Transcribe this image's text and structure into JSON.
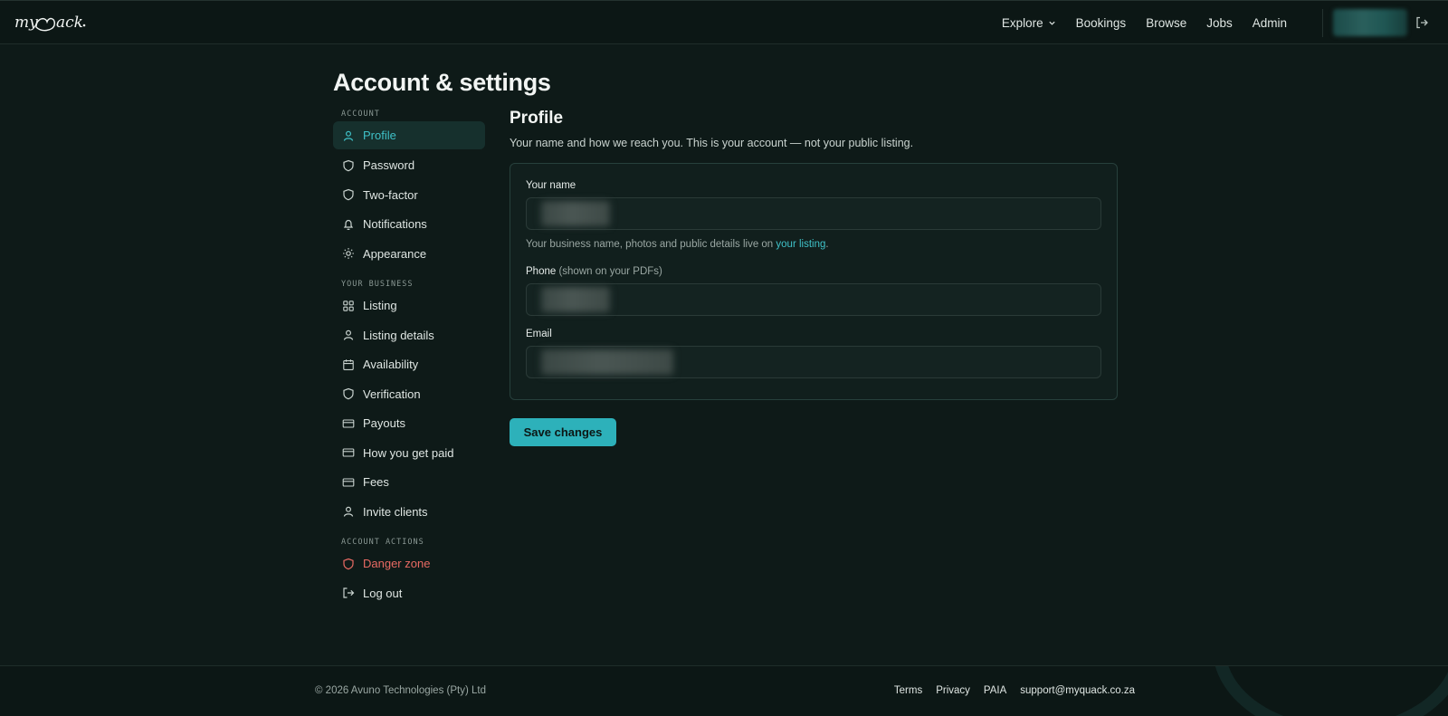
{
  "brand": {
    "logo_text": "myQuack"
  },
  "nav": {
    "items": [
      {
        "label": "Explore",
        "has_dropdown": true
      },
      {
        "label": "Bookings"
      },
      {
        "label": "Browse"
      },
      {
        "label": "Jobs"
      },
      {
        "label": "Admin"
      }
    ]
  },
  "page": {
    "title": "Account & settings"
  },
  "sidebar": {
    "sections": [
      {
        "heading": "ACCOUNT",
        "items": [
          {
            "label": "Profile",
            "icon": "user-icon",
            "active": true
          },
          {
            "label": "Password",
            "icon": "shield-icon"
          },
          {
            "label": "Two-factor",
            "icon": "shield-icon"
          },
          {
            "label": "Notifications",
            "icon": "bell-icon"
          },
          {
            "label": "Appearance",
            "icon": "sun-icon"
          }
        ]
      },
      {
        "heading": "YOUR BUSINESS",
        "items": [
          {
            "label": "Listing",
            "icon": "grid-icon"
          },
          {
            "label": "Listing details",
            "icon": "user-icon"
          },
          {
            "label": "Availability",
            "icon": "calendar-icon"
          },
          {
            "label": "Verification",
            "icon": "shield-icon"
          },
          {
            "label": "Payouts",
            "icon": "card-icon"
          },
          {
            "label": "How you get paid",
            "icon": "card-icon"
          },
          {
            "label": "Fees",
            "icon": "card-icon"
          },
          {
            "label": "Invite clients",
            "icon": "user-icon"
          }
        ]
      },
      {
        "heading": "ACCOUNT ACTIONS",
        "items": [
          {
            "label": "Danger zone",
            "icon": "shield-icon",
            "danger": true
          },
          {
            "label": "Log out",
            "icon": "logout-icon"
          }
        ]
      }
    ]
  },
  "profile": {
    "title": "Profile",
    "subtitle": "Your name and how we reach you. This is your account — not your public listing.",
    "name_label": "Your name",
    "help_text": "Your business name, photos and public details live on ",
    "help_link": "your listing",
    "help_suffix": ".",
    "phone_label": "Phone",
    "phone_hint": " (shown on your PDFs)",
    "email_label": "Email",
    "save_label": "Save changes"
  },
  "footer": {
    "copyright": "© 2026 Avuno Technologies (Pty) Ltd",
    "links": [
      "Terms",
      "Privacy",
      "PAIA",
      "support@myquack.co.za"
    ]
  },
  "colors": {
    "background": "#0e1a18",
    "accent": "#2db1ba",
    "active_text": "#3fc1c8",
    "danger": "#e86a63"
  }
}
